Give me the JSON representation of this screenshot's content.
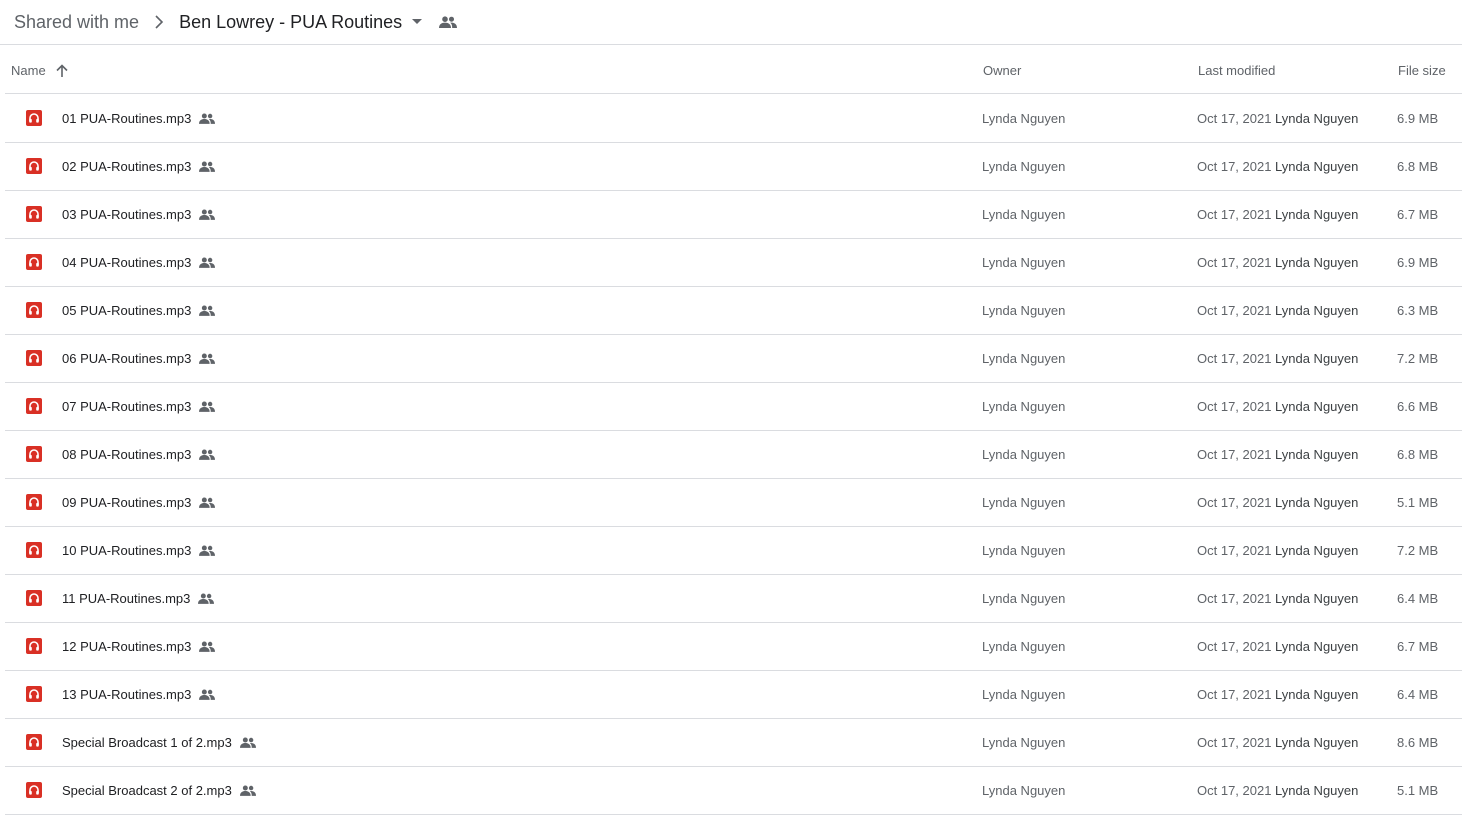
{
  "breadcrumb": {
    "parent": "Shared with me",
    "current": "Ben Lowrey - PUA Routines"
  },
  "columns": {
    "name": "Name",
    "owner": "Owner",
    "last_modified": "Last modified",
    "file_size": "File size"
  },
  "colors": {
    "audio_icon": "#d93025",
    "divider": "#dadce0",
    "secondary_text": "#5f6368"
  },
  "files": [
    {
      "name": "01 PUA-Routines.mp3",
      "owner": "Lynda Nguyen",
      "date": "Oct 17, 2021",
      "modifier": "Lynda Nguyen",
      "size": "6.9 MB"
    },
    {
      "name": "02 PUA-Routines.mp3",
      "owner": "Lynda Nguyen",
      "date": "Oct 17, 2021",
      "modifier": "Lynda Nguyen",
      "size": "6.8 MB"
    },
    {
      "name": "03 PUA-Routines.mp3",
      "owner": "Lynda Nguyen",
      "date": "Oct 17, 2021",
      "modifier": "Lynda Nguyen",
      "size": "6.7 MB"
    },
    {
      "name": "04 PUA-Routines.mp3",
      "owner": "Lynda Nguyen",
      "date": "Oct 17, 2021",
      "modifier": "Lynda Nguyen",
      "size": "6.9 MB"
    },
    {
      "name": "05 PUA-Routines.mp3",
      "owner": "Lynda Nguyen",
      "date": "Oct 17, 2021",
      "modifier": "Lynda Nguyen",
      "size": "6.3 MB"
    },
    {
      "name": "06 PUA-Routines.mp3",
      "owner": "Lynda Nguyen",
      "date": "Oct 17, 2021",
      "modifier": "Lynda Nguyen",
      "size": "7.2 MB"
    },
    {
      "name": "07 PUA-Routines.mp3",
      "owner": "Lynda Nguyen",
      "date": "Oct 17, 2021",
      "modifier": "Lynda Nguyen",
      "size": "6.6 MB"
    },
    {
      "name": "08 PUA-Routines.mp3",
      "owner": "Lynda Nguyen",
      "date": "Oct 17, 2021",
      "modifier": "Lynda Nguyen",
      "size": "6.8 MB"
    },
    {
      "name": "09 PUA-Routines.mp3",
      "owner": "Lynda Nguyen",
      "date": "Oct 17, 2021",
      "modifier": "Lynda Nguyen",
      "size": "5.1 MB"
    },
    {
      "name": "10 PUA-Routines.mp3",
      "owner": "Lynda Nguyen",
      "date": "Oct 17, 2021",
      "modifier": "Lynda Nguyen",
      "size": "7.2 MB"
    },
    {
      "name": "11 PUA-Routines.mp3",
      "owner": "Lynda Nguyen",
      "date": "Oct 17, 2021",
      "modifier": "Lynda Nguyen",
      "size": "6.4 MB"
    },
    {
      "name": "12 PUA-Routines.mp3",
      "owner": "Lynda Nguyen",
      "date": "Oct 17, 2021",
      "modifier": "Lynda Nguyen",
      "size": "6.7 MB"
    },
    {
      "name": "13 PUA-Routines.mp3",
      "owner": "Lynda Nguyen",
      "date": "Oct 17, 2021",
      "modifier": "Lynda Nguyen",
      "size": "6.4 MB"
    },
    {
      "name": "Special Broadcast 1 of 2.mp3",
      "owner": "Lynda Nguyen",
      "date": "Oct 17, 2021",
      "modifier": "Lynda Nguyen",
      "size": "8.6 MB"
    },
    {
      "name": "Special Broadcast 2 of 2.mp3",
      "owner": "Lynda Nguyen",
      "date": "Oct 17, 2021",
      "modifier": "Lynda Nguyen",
      "size": "5.1 MB"
    }
  ]
}
